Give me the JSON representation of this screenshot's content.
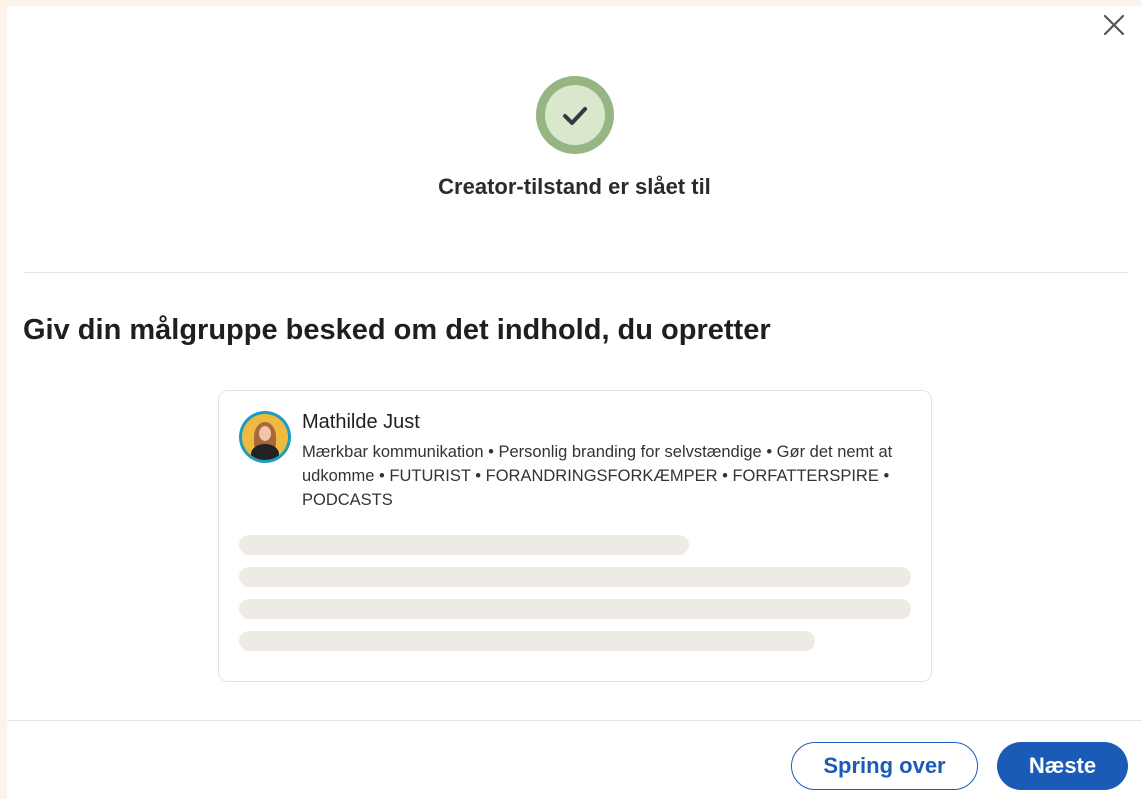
{
  "dialog": {
    "close_icon": "close-icon",
    "status_icon": "checkmark-icon",
    "status_title": "Creator-tilstand er slået til",
    "heading": "Giv din målgruppe besked om det indhold, du opretter"
  },
  "preview": {
    "author_name": "Mathilde Just",
    "headline": "Mærkbar kommunikation • Personlig branding for selvstændige • Gør det nemt at udkomme • FUTURIST • FORANDRINGSFORKÆMPER • FORFATTERSPIRE • PODCASTS"
  },
  "footer": {
    "skip_label": "Spring over",
    "next_label": "Næste"
  },
  "colors": {
    "accent": "#1a5bb8",
    "page_background": "#fcf3eb",
    "success_outer": "#97b583",
    "success_inner": "#d9e8cc",
    "skeleton": "#eeebe7"
  }
}
